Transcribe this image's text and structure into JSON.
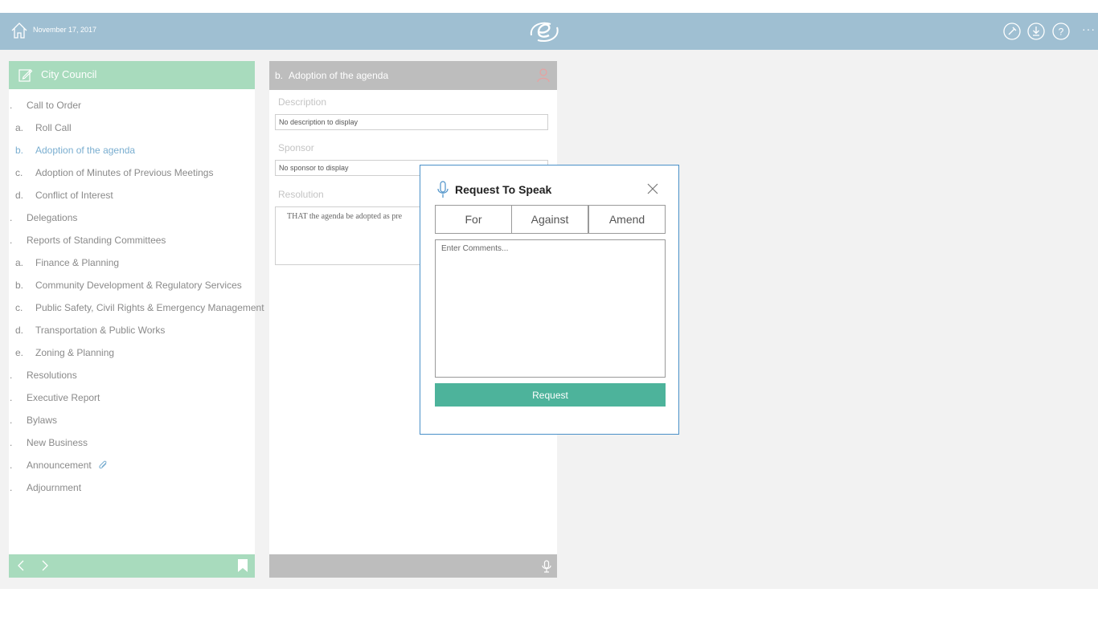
{
  "topbar": {
    "date": "November 17, 2017",
    "more_label": "···",
    "icons": [
      "home-icon",
      "logo-icon",
      "pin-icon",
      "download-icon",
      "help-icon"
    ]
  },
  "left_panel": {
    "title": "City Council",
    "items": [
      {
        "num": ".",
        "label": "Call to Order",
        "level": "top"
      },
      {
        "num": "a.",
        "label": "Roll Call",
        "level": "sub"
      },
      {
        "num": "b.",
        "label": "Adoption of the agenda",
        "level": "sub",
        "active": true
      },
      {
        "num": "c.",
        "label": "Adoption of Minutes of Previous Meetings",
        "level": "sub"
      },
      {
        "num": "d.",
        "label": "Conflict of Interest",
        "level": "sub"
      },
      {
        "num": ".",
        "label": "Delegations",
        "level": "top"
      },
      {
        "num": ".",
        "label": "Reports of Standing Committees",
        "level": "top"
      },
      {
        "num": "a.",
        "label": "Finance & Planning",
        "level": "sub"
      },
      {
        "num": "b.",
        "label": "Community Development & Regulatory Services",
        "level": "sub"
      },
      {
        "num": "c.",
        "label": "Public Safety, Civil Rights & Emergency Management",
        "level": "sub"
      },
      {
        "num": "d.",
        "label": "Transportation & Public Works",
        "level": "sub"
      },
      {
        "num": "e.",
        "label": "Zoning & Planning",
        "level": "sub"
      },
      {
        "num": ".",
        "label": "Resolutions",
        "level": "top"
      },
      {
        "num": ".",
        "label": "Executive Report",
        "level": "top"
      },
      {
        "num": ".",
        "label": "Bylaws",
        "level": "top"
      },
      {
        "num": ".",
        "label": "New Business",
        "level": "top"
      },
      {
        "num": ".",
        "label": "Announcement",
        "level": "top",
        "attachment": true
      },
      {
        "num": ".",
        "label": "Adjournment",
        "level": "top"
      }
    ]
  },
  "detail": {
    "item_num": "b.",
    "title": "Adoption of the agenda",
    "description_label": "Description",
    "description_value": "No description to display",
    "sponsor_label": "Sponsor",
    "sponsor_value": "No sponsor to display",
    "resolution_label": "Resolution",
    "resolution_text": "THAT the agenda be adopted as pre"
  },
  "dialog": {
    "title": "Request To Speak",
    "options": [
      "For",
      "Against",
      "Amend"
    ],
    "comments_placeholder": "Enter Comments...",
    "submit_label": "Request"
  },
  "colors": {
    "topbar": "#9fbfd2",
    "left_header": "#a8dbbd",
    "active_item": "#7aaed0",
    "request_button": "#4db39b",
    "dialog_border": "#4a90c8"
  }
}
